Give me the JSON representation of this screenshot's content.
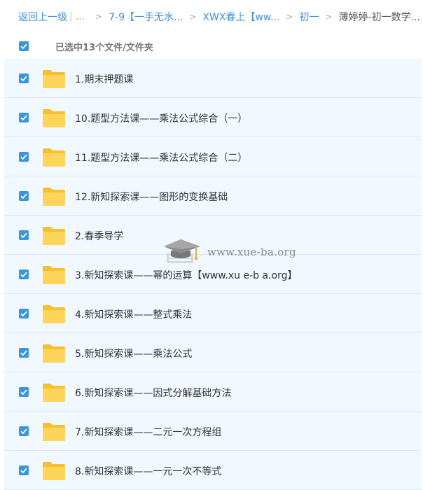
{
  "breadcrumb": {
    "back_label": "返回上一级",
    "divider": "|",
    "ellipsis": "...",
    "separator": ">",
    "items": [
      "7-9【一手无水...",
      "XWX春上【ww...",
      "初一",
      "薄婷婷-初一数学..."
    ]
  },
  "selection": {
    "summary": "已选中13个文件/文件夹"
  },
  "files": [
    {
      "name": "1.期末押题课",
      "checked": true
    },
    {
      "name": "10.题型方法课——乘法公式综合（一）",
      "checked": true
    },
    {
      "name": "11.题型方法课——乘法公式综合（二）",
      "checked": true
    },
    {
      "name": "12.新知探索课——图形的变换基础",
      "checked": true
    },
    {
      "name": "2.春季导学",
      "checked": true
    },
    {
      "name": "3.新知探索课——幂的运算【www.xu e-b a.org】",
      "checked": true
    },
    {
      "name": "4.新知探索课——整式乘法",
      "checked": true
    },
    {
      "name": "5.新知探索课——乘法公式",
      "checked": true
    },
    {
      "name": "6.新知探索课——因式分解基础方法",
      "checked": true
    },
    {
      "name": "7.新知探索课——二元一次方程组",
      "checked": true
    },
    {
      "name": "8.新知探索课——一元一次不等式",
      "checked": true
    }
  ],
  "watermark": {
    "text": "www.xue-ba.org"
  },
  "colors": {
    "link": "#3b8cd9",
    "checkbox": "#3a95dd",
    "row_bg": "#f1f8ff",
    "folder": "#ffd04a"
  }
}
